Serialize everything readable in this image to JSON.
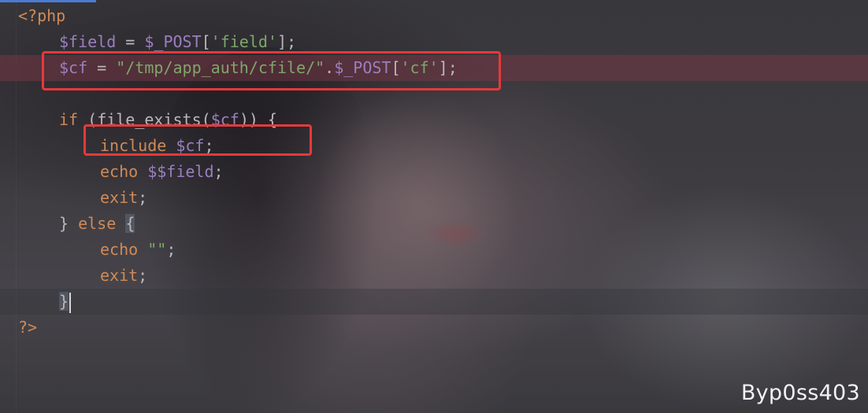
{
  "editor": {
    "language": "php",
    "colors": {
      "keyword_or_tag": "#d08a58",
      "variable": "#9c7fbf",
      "string": "#7fa66a",
      "plain": "#b8b8bc",
      "highlight_line": "#823746",
      "annotation_box": "#e43a3a",
      "tab_indicator": "#4b7bd6"
    },
    "lines": [
      {
        "tokens": [
          {
            "t": "tag",
            "v": "<?php"
          }
        ]
      },
      {
        "tokens": [
          {
            "t": "var",
            "v": "$field"
          },
          {
            "t": "punc",
            "v": " = "
          },
          {
            "t": "var",
            "v": "$_POST"
          },
          {
            "t": "punc",
            "v": "["
          },
          {
            "t": "str",
            "v": "'field'"
          },
          {
            "t": "punc",
            "v": "];"
          }
        ]
      },
      {
        "tokens": [
          {
            "t": "var",
            "v": "$cf"
          },
          {
            "t": "punc",
            "v": " = "
          },
          {
            "t": "str",
            "v": "\"/tmp/app_auth/cfile/\""
          },
          {
            "t": "punc",
            "v": "."
          },
          {
            "t": "var",
            "v": "$_POST"
          },
          {
            "t": "punc",
            "v": "["
          },
          {
            "t": "str",
            "v": "'cf'"
          },
          {
            "t": "punc",
            "v": "];"
          }
        ]
      },
      {
        "tokens": []
      },
      {
        "tokens": [
          {
            "t": "kw",
            "v": "if"
          },
          {
            "t": "punc",
            "v": " ("
          },
          {
            "t": "fn",
            "v": "file_exists"
          },
          {
            "t": "punc",
            "v": "("
          },
          {
            "t": "var",
            "v": "$cf"
          },
          {
            "t": "punc",
            "v": ")) {"
          }
        ]
      },
      {
        "tokens": [
          {
            "t": "kw",
            "v": "include"
          },
          {
            "t": "punc",
            "v": " "
          },
          {
            "t": "var",
            "v": "$cf"
          },
          {
            "t": "punc",
            "v": ";"
          }
        ]
      },
      {
        "tokens": [
          {
            "t": "kw",
            "v": "echo"
          },
          {
            "t": "punc",
            "v": " "
          },
          {
            "t": "var",
            "v": "$$field"
          },
          {
            "t": "punc",
            "v": ";"
          }
        ]
      },
      {
        "tokens": [
          {
            "t": "kw",
            "v": "exit"
          },
          {
            "t": "punc",
            "v": ";"
          }
        ]
      },
      {
        "tokens": [
          {
            "t": "punc",
            "v": "} "
          },
          {
            "t": "kw",
            "v": "else"
          },
          {
            "t": "punc",
            "v": " "
          },
          {
            "t": "brace",
            "v": "{"
          }
        ]
      },
      {
        "tokens": [
          {
            "t": "kw",
            "v": "echo"
          },
          {
            "t": "punc",
            "v": " "
          },
          {
            "t": "str",
            "v": "\"\""
          },
          {
            "t": "punc",
            "v": ";"
          }
        ]
      },
      {
        "tokens": [
          {
            "t": "kw",
            "v": "exit"
          },
          {
            "t": "punc",
            "v": ";"
          }
        ]
      },
      {
        "tokens": [
          {
            "t": "brace",
            "v": "}"
          }
        ],
        "caret": true
      },
      {
        "tokens": [
          {
            "t": "tag",
            "v": "?>"
          }
        ]
      }
    ]
  },
  "watermark": "Byp0ss403"
}
